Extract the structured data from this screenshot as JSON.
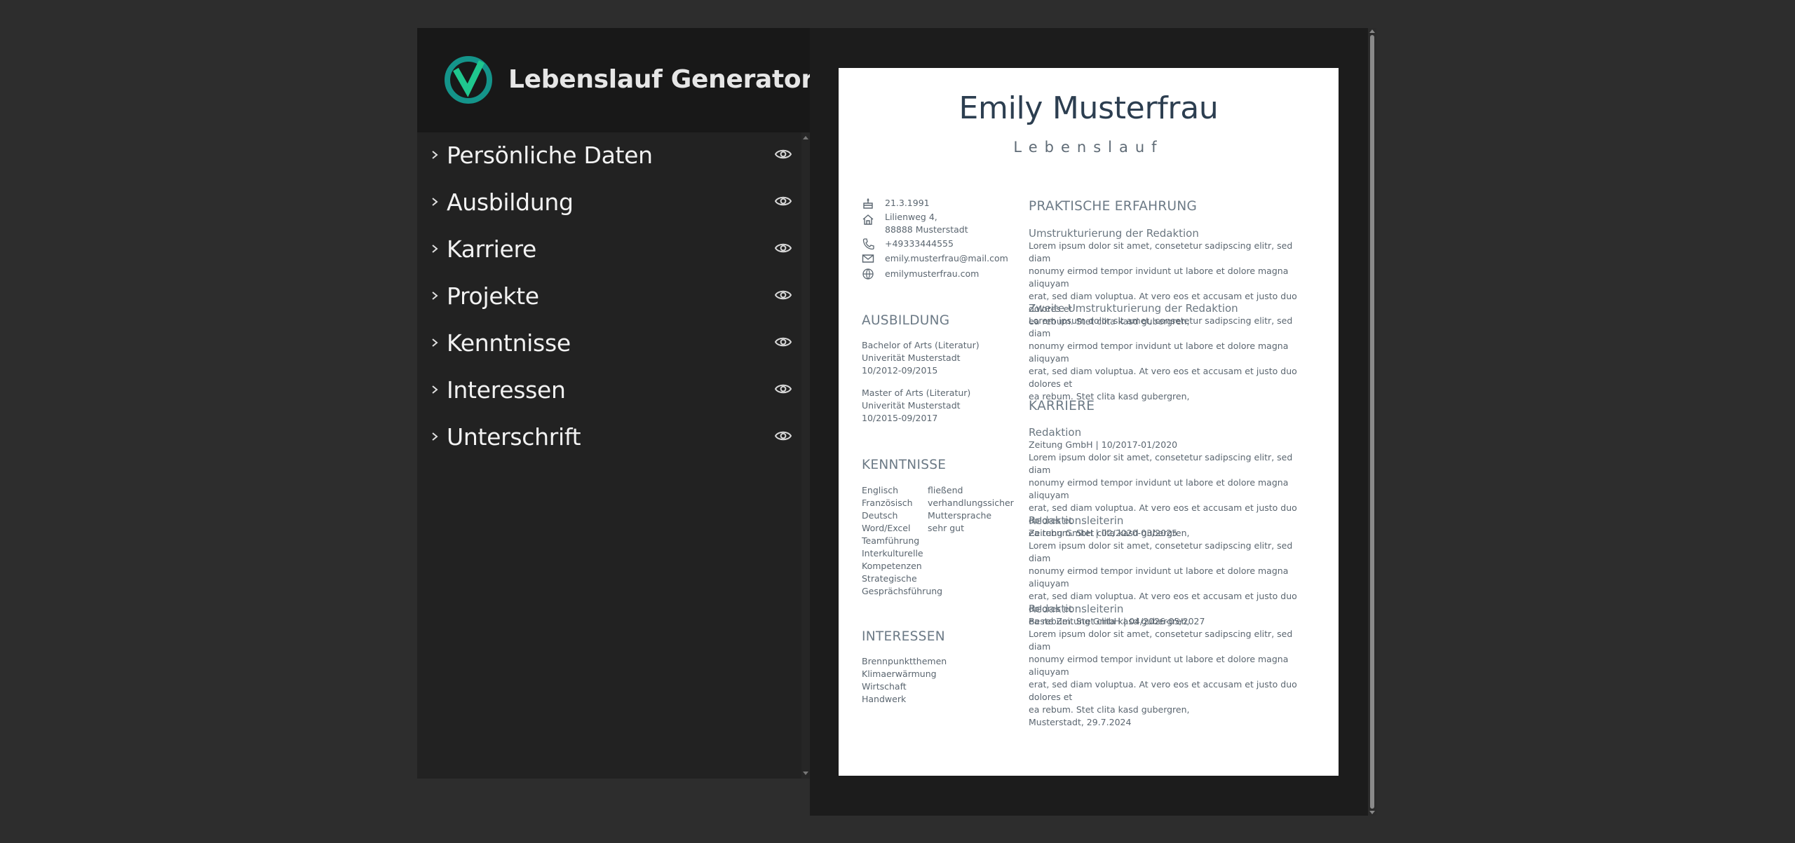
{
  "app": {
    "title": "Lebenslauf Generator"
  },
  "sidebar": {
    "sections": [
      {
        "label": "Persönliche Daten"
      },
      {
        "label": "Ausbildung"
      },
      {
        "label": "Karriere"
      },
      {
        "label": "Projekte"
      },
      {
        "label": "Kenntnisse"
      },
      {
        "label": "Interessen"
      },
      {
        "label": "Unterschrift"
      }
    ]
  },
  "colors": {
    "accent_green": "#1fc78e",
    "accent_teal": "#14948a"
  },
  "icons": {
    "section_expand": "chevron-right-icon",
    "section_visibility": "eye-icon",
    "birth": "cake-icon",
    "address": "home-icon",
    "phone": "phone-icon",
    "email": "mail-icon",
    "web": "globe-icon"
  },
  "cv": {
    "name": "Emily Musterfrau",
    "subtitle": "Lebenslauf",
    "contact": {
      "birthdate": "21.3.1991",
      "address_line1": "Lilienweg 4,",
      "address_line2": "88888 Musterstadt",
      "phone": "+49333444555",
      "email": "emily.musterfrau@mail.com",
      "website": "emilymusterfrau.com"
    },
    "education": {
      "heading": "AUSBILDUNG",
      "entries": [
        {
          "degree": "Bachelor of Arts (Literatur)",
          "school": "Univerität Musterstadt",
          "period": "10/2012-09/2015"
        },
        {
          "degree": "Master of Arts (Literatur)",
          "school": "Univerität Musterstadt",
          "period": "10/2015-09/2017"
        }
      ]
    },
    "skills": {
      "heading": "KENNTNISSE",
      "names": [
        "Englisch",
        "Französisch",
        "Deutsch",
        "Word/Excel",
        "Teamführung",
        "Interkulturelle",
        "Kompetenzen",
        "Strategische",
        "Gesprächsführung"
      ],
      "levels": [
        "fließend",
        "verhandlungssicher",
        "Muttersprache",
        "sehr gut"
      ]
    },
    "interests": {
      "heading": "INTERESSEN",
      "items": [
        "Brennpunktthemen",
        "Klimaerwärmung",
        "Wirtschaft",
        "Handwerk"
      ]
    },
    "experience": {
      "heading": "PRAKTISCHE ERFAHRUNG",
      "entries": [
        {
          "title": "Umstrukturierung der Redaktion",
          "lines": [
            "Lorem ipsum dolor sit amet, consetetur sadipscing elitr, sed diam",
            "nonumy eirmod tempor invidunt ut labore et dolore magna aliquyam",
            "erat, sed diam voluptua. At vero eos et accusam et justo duo dolores et",
            "ea rebum. Stet clita kasd gubergren,"
          ]
        },
        {
          "title": "Zweite Umstrukturierung der Redaktion",
          "lines": [
            "Lorem ipsum dolor sit amet, consetetur sadipscing elitr, sed diam",
            "nonumy eirmod tempor invidunt ut labore et dolore magna aliquyam",
            "erat, sed diam voluptua. At vero eos et accusam et justo duo dolores et",
            "ea rebum. Stet clita kasd gubergren,"
          ]
        }
      ]
    },
    "career": {
      "heading": "KARRIERE",
      "entries": [
        {
          "title": "Redaktion",
          "meta": "Zeitung GmbH | 10/2017-01/2020",
          "lines": [
            "Lorem ipsum dolor sit amet, consetetur sadipscing elitr, sed diam",
            "nonumy eirmod tempor invidunt ut labore et dolore magna aliquyam",
            "erat, sed diam voluptua. At vero eos et accusam et justo duo dolores et",
            "ea rebum. Stet clita kasd gubergren,"
          ]
        },
        {
          "title": "Redaktionsleiterin",
          "meta": "Zeitung GmbH | 02/2020-03/2025",
          "lines": [
            "Lorem ipsum dolor sit amet, consetetur sadipscing elitr, sed diam",
            "nonumy eirmod tempor invidunt ut labore et dolore magna aliquyam",
            "erat, sed diam voluptua. At vero eos et accusam et justo duo dolores et",
            "ea rebum. Stet clita kasd gubergren,"
          ]
        },
        {
          "title": "Redaktionsleiterin",
          "meta": "Beste Zeitung GmbH | 04/2026-05/2027",
          "lines": [
            "Lorem ipsum dolor sit amet, consetetur sadipscing elitr, sed diam",
            "nonumy eirmod tempor invidunt ut labore et dolore magna aliquyam",
            "erat, sed diam voluptua. At vero eos et accusam et justo duo dolores et",
            "ea rebum. Stet clita kasd gubergren,"
          ]
        }
      ]
    },
    "signature_place_date": "Musterstadt, 29.7.2024"
  }
}
